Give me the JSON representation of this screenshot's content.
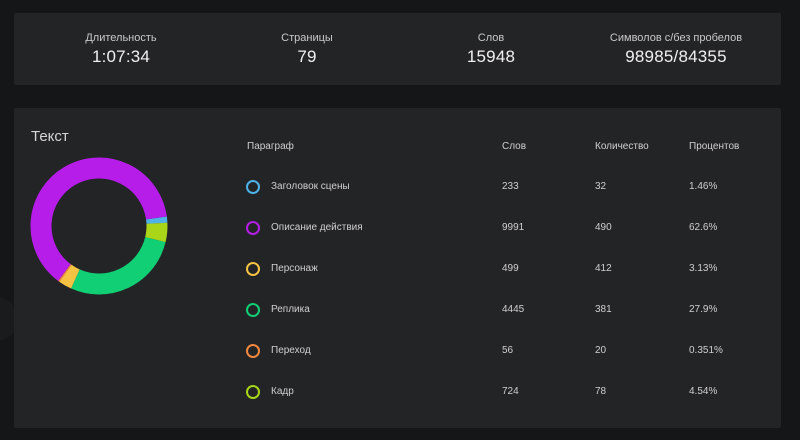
{
  "stats": [
    {
      "label": "Длительность",
      "value": "1:07:34"
    },
    {
      "label": "Страницы",
      "value": "79"
    },
    {
      "label": "Слов",
      "value": "15948"
    },
    {
      "label": "Символов с/без пробелов",
      "value": "98985/84355"
    }
  ],
  "text_card": {
    "title": "Текст",
    "headers": {
      "paragraph": "Параграф",
      "words": "Слов",
      "count": "Количество",
      "percent": "Процентов"
    },
    "rows": [
      {
        "name": "Заголовок сцены",
        "words": "233",
        "count": "32",
        "percent": "1.46%",
        "color": "#4fb3e8"
      },
      {
        "name": "Описание действия",
        "words": "9991",
        "count": "490",
        "percent": "62.6%",
        "color": "#b71de9"
      },
      {
        "name": "Персонаж",
        "words": "499",
        "count": "412",
        "percent": "3.13%",
        "color": "#f5c344"
      },
      {
        "name": "Реплика",
        "words": "4445",
        "count": "381",
        "percent": "27.9%",
        "color": "#11cf74"
      },
      {
        "name": "Переход",
        "words": "56",
        "count": "20",
        "percent": "0.351%",
        "color": "#f2893e"
      },
      {
        "name": "Кадр",
        "words": "724",
        "count": "78",
        "percent": "4.54%",
        "color": "#a9d619"
      }
    ]
  },
  "chart_data": {
    "type": "pie",
    "style": "donut",
    "categories": [
      "Заголовок сцены",
      "Описание действия",
      "Персонаж",
      "Реплика",
      "Переход",
      "Кадр"
    ],
    "values": [
      1.46,
      62.6,
      3.13,
      27.9,
      0.351,
      4.54
    ],
    "colors": [
      "#4fb3e8",
      "#b71de9",
      "#f5c344",
      "#11cf74",
      "#f2893e",
      "#a9d619"
    ]
  }
}
